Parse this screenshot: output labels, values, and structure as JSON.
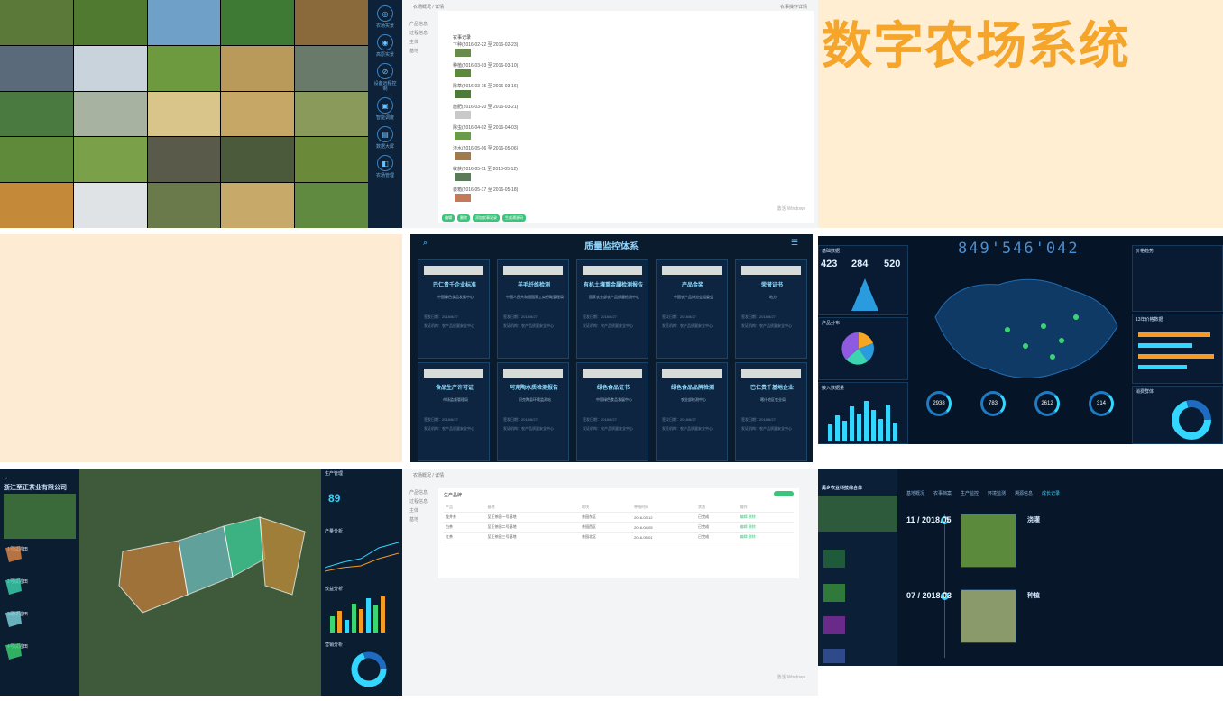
{
  "tile1": {
    "side_nav": [
      "农场实景",
      "高原实景",
      "设备远程控制",
      "智能调度",
      "数据大屏",
      "农场管理"
    ]
  },
  "tile2": {
    "breadcrumb": "农场概况 / 详情",
    "top_right": "农事操作详情",
    "left_nav": [
      "产品信息",
      "过程信息",
      "主体",
      "基地"
    ],
    "header": "农事记录",
    "entries": [
      "下种(2016-02-22 至 2016-02-23)",
      "种植(2016-03-03 至 2016-03-10)",
      "除草(2016-03-15 至 2016-03-16)",
      "施肥(2016-03-20 至 2016-03-21)",
      "除虫(2016-04-02 至 2016-04-03)",
      "浇水(2016-05-06 至 2016-05-06)",
      "收获(2016-05-11 至 2016-05-12)",
      "装箱(2016-05-17 至 2016-05-18)"
    ],
    "buttons": [
      "编辑",
      "删除",
      "添加农事记录",
      "生成溯源码"
    ],
    "watermark": "激活 Windows"
  },
  "tile3": {
    "title": "数字农场系统"
  },
  "tile5": {
    "title": "质量监控体系",
    "cards": [
      {
        "name": "巴仁贵千企业标准",
        "org": "中国绿色食品发展中心"
      },
      {
        "name": "羊毛纤维检测",
        "org": "中国人民共和国国家工商行政管理局"
      },
      {
        "name": "有机土壤重金属检测报告",
        "org": "国家农业部农产品质量检测中心"
      },
      {
        "name": "产品金奖",
        "org": "中国农产品博览会组委会"
      },
      {
        "name": "荣誉证书",
        "org": "地方"
      },
      {
        "name": "食品生产许可证",
        "org": "市场监督管理局"
      },
      {
        "name": "阿克陶水质检测报告",
        "org": "阿克陶县环境监测站"
      },
      {
        "name": "绿色食品证书",
        "org": "中国绿色食品发展中心"
      },
      {
        "name": "绿色食品品牌检测",
        "org": "农业部检测中心"
      },
      {
        "name": "巴仁贵千基地企业",
        "org": "喀什地区农业局"
      }
    ],
    "card_lines": [
      "签发日期：2018/8/27",
      "发证机构：农产品质量安全中心"
    ]
  },
  "tile6": {
    "big_number": "849'546'042",
    "panels": [
      "基础数据",
      "产品分布",
      "接入数据量",
      "价格趋势",
      "13年价格数据",
      "消费群体"
    ],
    "gauges": [
      "2938",
      "783",
      "2612",
      "314"
    ],
    "left_nums": [
      "423",
      "284",
      "520"
    ]
  },
  "tile7": {
    "company": "浙江至正茶业有限公司",
    "fields": [
      "1号试验田",
      "2号试验田",
      "3号试验田",
      "4号试验田"
    ],
    "right_titles": [
      "生产管理",
      "产量分析",
      "效益分析",
      "营销分析"
    ],
    "gauge_value": "89"
  },
  "tile8": {
    "breadcrumb": "农场概况 / 详情",
    "header": "生产品牌",
    "columns": [
      "产品",
      "基地",
      "地块",
      "种植时间",
      "状态",
      "操作"
    ],
    "rows": [
      [
        "龙井茶",
        "至正茶园一号基地",
        "茶园东区",
        "2016-03-12",
        "已完成",
        "编辑 删除"
      ],
      [
        "白茶",
        "至正茶园二号基地",
        "茶园西区",
        "2016-04-05",
        "已完成",
        "编辑 删除"
      ],
      [
        "红茶",
        "至正茶园三号基地",
        "茶园北区",
        "2016-05-01",
        "已完成",
        "编辑 删除"
      ]
    ]
  },
  "tile9": {
    "title": "禹乡农业科技综合体",
    "tabs": [
      "基地概况",
      "农事档案",
      "生产监控",
      "环境监测",
      "溯源信息",
      "成长记录"
    ],
    "entries": [
      {
        "date": "11 / 2018.05",
        "label": "浇灌"
      },
      {
        "date": "07 / 2018.03",
        "label": "种植"
      }
    ]
  }
}
